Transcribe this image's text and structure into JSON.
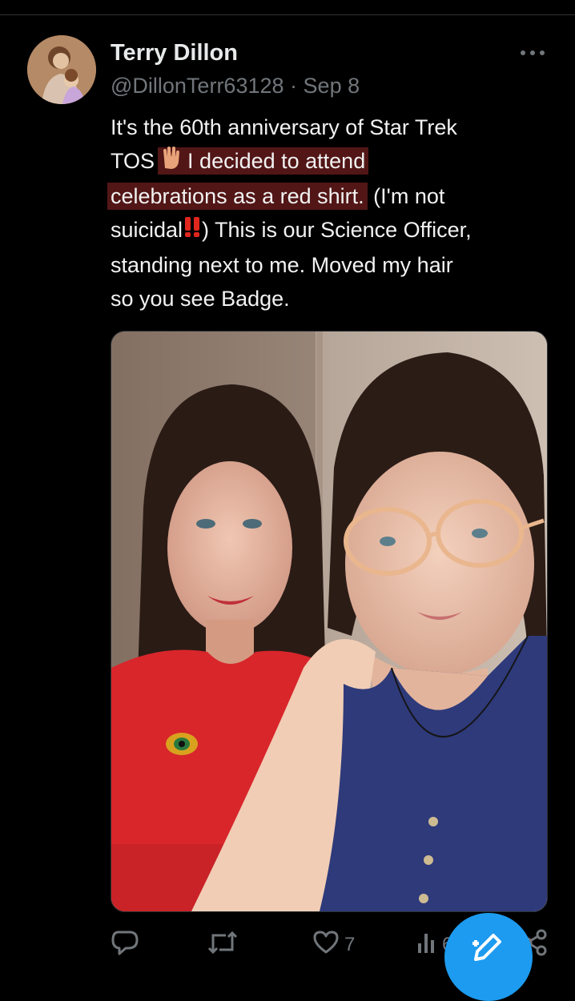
{
  "author": {
    "display_name": "Terry Dillon",
    "handle": "@DillonTerr63128",
    "separator": "·",
    "date": "Sep 8"
  },
  "tweet": {
    "lines": [
      "It's the 60th anniversary of Star Trek",
      "TOS",
      "I decided to attend",
      "celebrations as a red shirt.",
      " (I'm not",
      "suicidal",
      ") This is our Science Officer,",
      "standing next to me. Moved my hair",
      "so you see Badge."
    ]
  },
  "image": {
    "description_icon": "photo"
  },
  "actions": {
    "reply_count": "",
    "retweet_count": "",
    "like_count": "7",
    "views_count": "63"
  },
  "colors": {
    "background": "#000000",
    "text": "#e7e9ea",
    "muted": "#71767b",
    "accent": "#1d9bf0",
    "highlight": "#962828"
  },
  "icons": [
    "more-icon",
    "reply-icon",
    "retweet-icon",
    "like-icon",
    "views-icon",
    "share-icon",
    "compose-icon",
    "vulcan-salute-icon",
    "double-exclamation-icon"
  ]
}
